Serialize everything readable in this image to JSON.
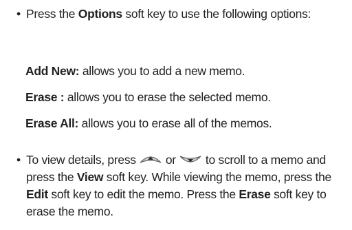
{
  "bullet_glyph": "•",
  "para1": {
    "t1": "Press the ",
    "b1": "Options",
    "t2": " soft key to use the following options:"
  },
  "options": [
    {
      "label": "Add New:",
      "desc": " allows you to add a new memo."
    },
    {
      "label": "Erase :",
      "desc": " allows you to erase the selected memo."
    },
    {
      "label": "Erase All:",
      "desc": " allows you to erase all of the memos."
    }
  ],
  "para2": {
    "t1": "To view details, press ",
    "or": " or ",
    "t2": " to scroll to a memo and press the ",
    "b1": "View",
    "t3": " soft key. While viewing the memo, press the ",
    "b2": "Edit",
    "t4": " soft key to edit the memo. Press the ",
    "b3": "Erase",
    "t5": " soft key to erase the memo."
  },
  "icons": {
    "up": "nav-up-key-icon",
    "down": "nav-down-key-icon"
  }
}
